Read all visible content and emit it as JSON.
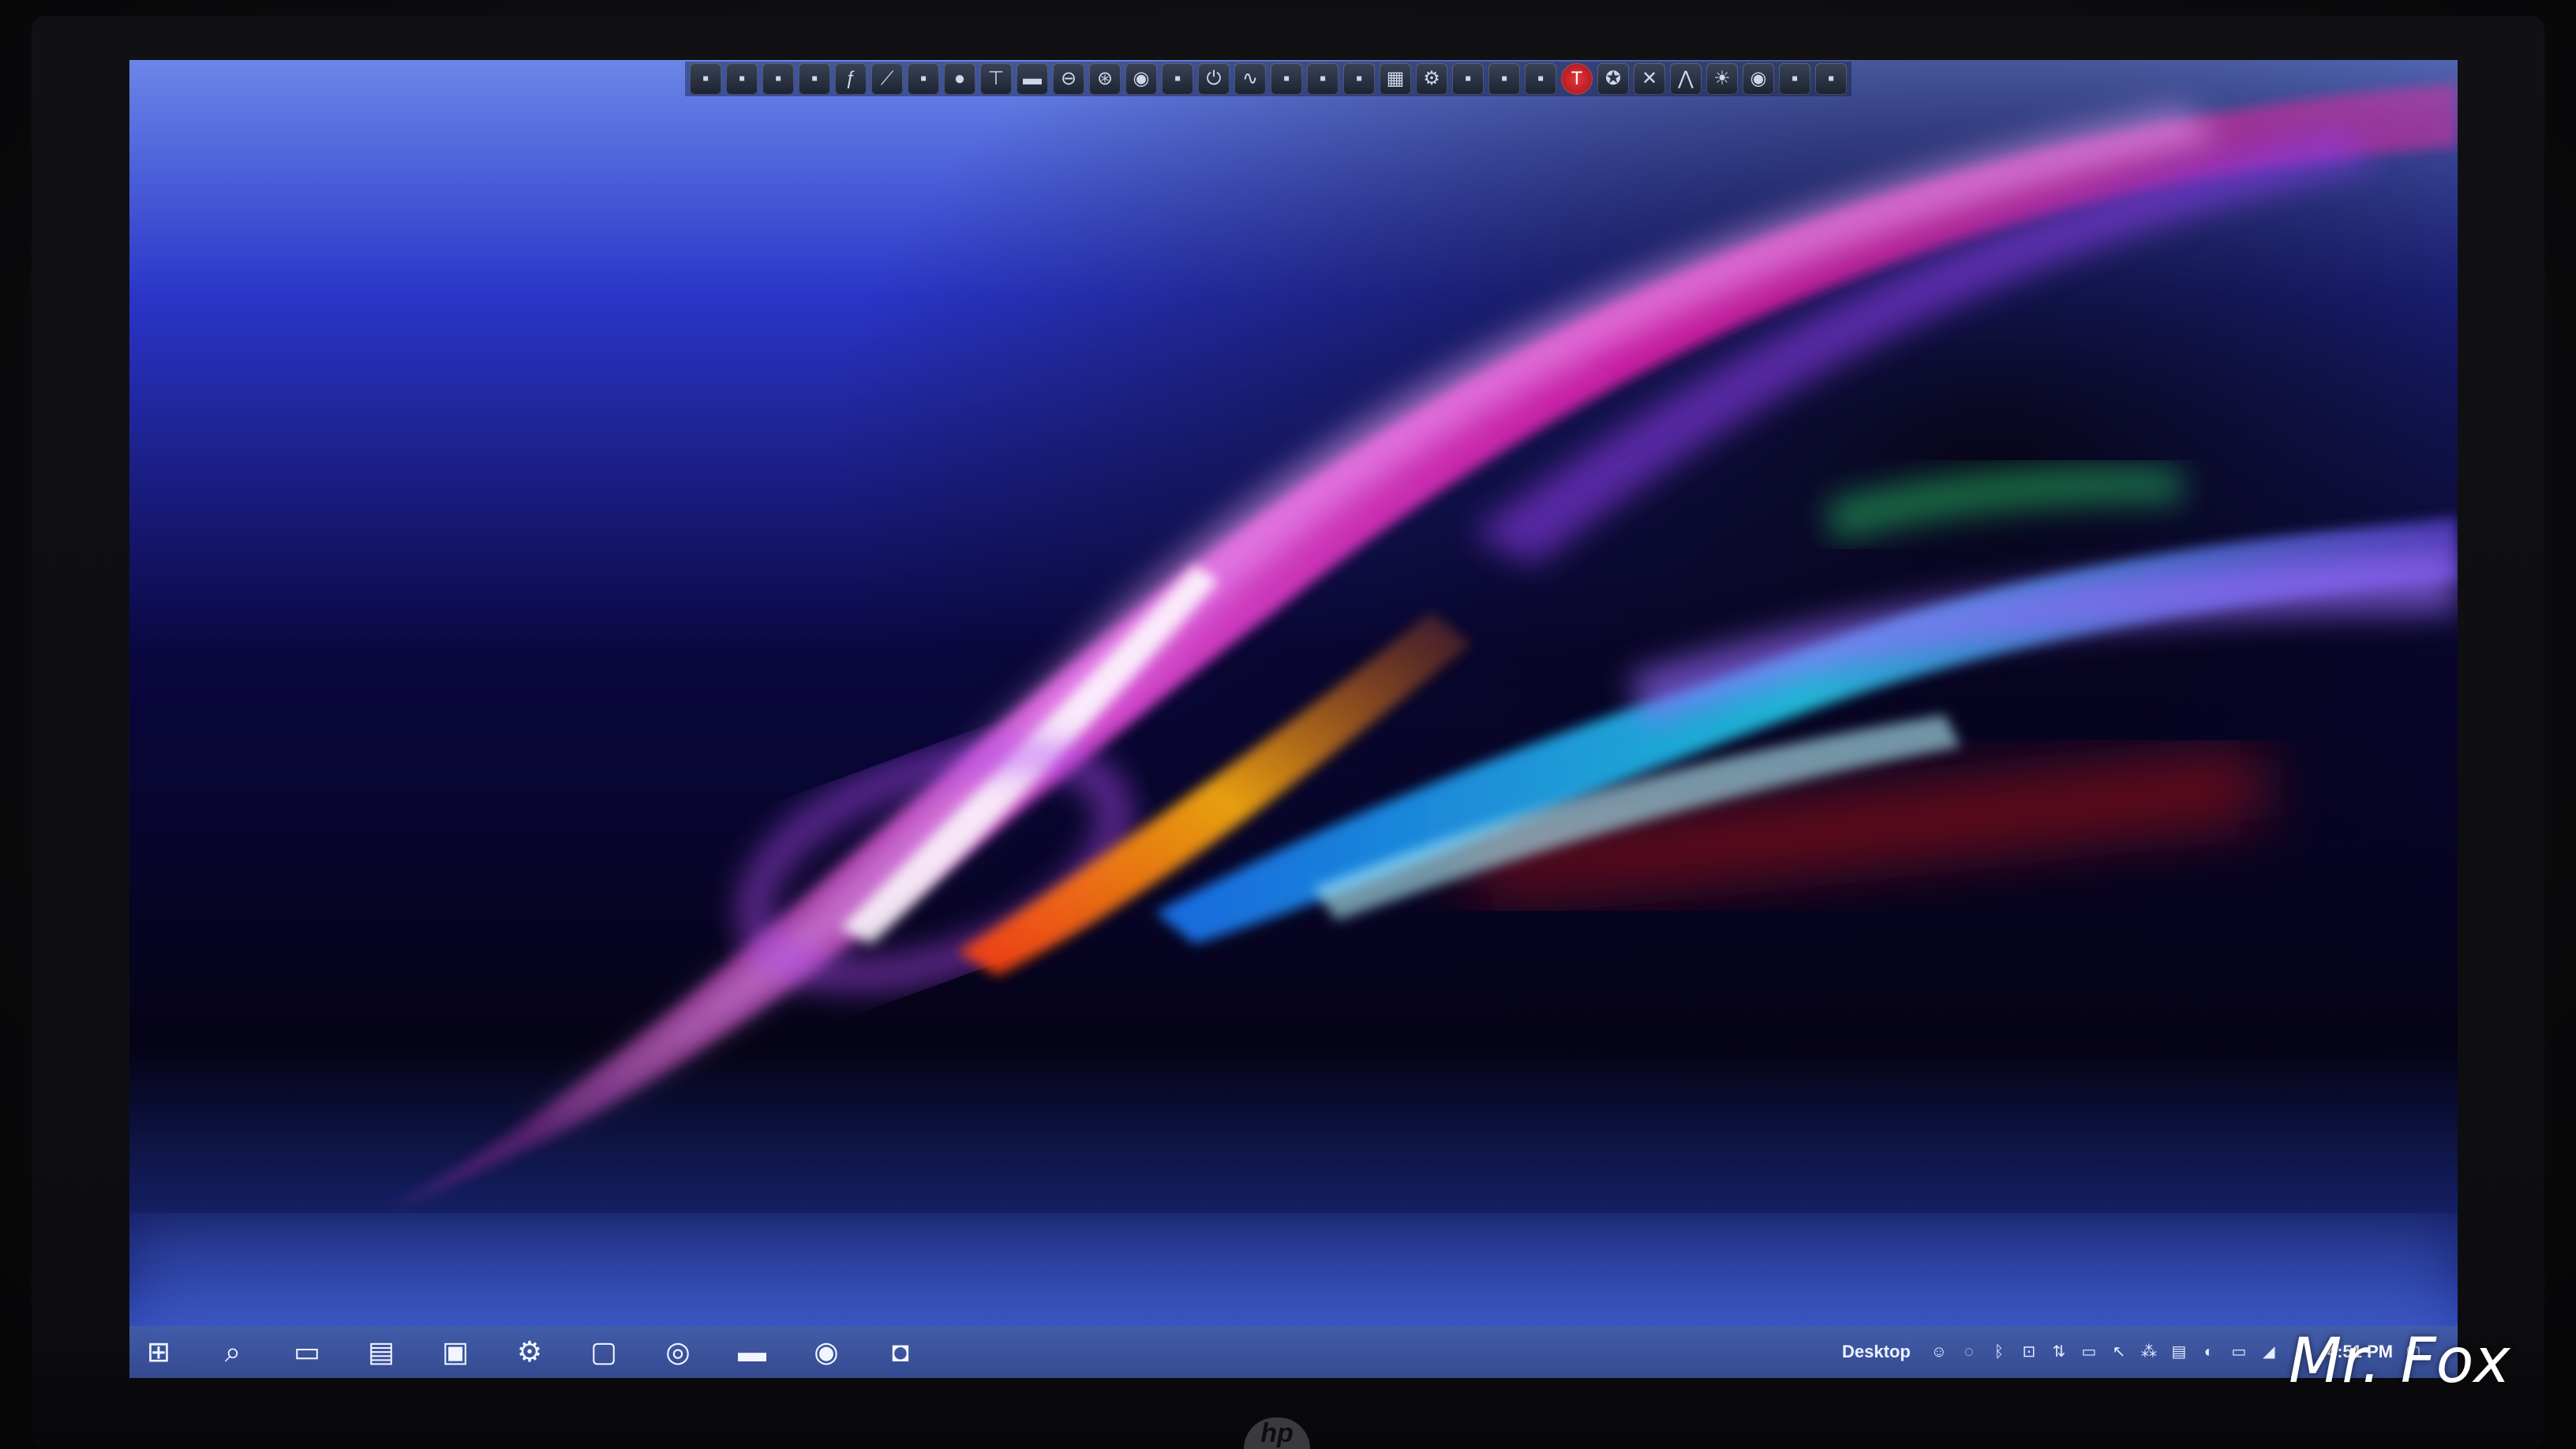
{
  "top_dock": {
    "icons": [
      {
        "name": "app-icon",
        "glyph": "▪"
      },
      {
        "name": "app-icon",
        "glyph": "▪"
      },
      {
        "name": "app-icon",
        "glyph": "▪"
      },
      {
        "name": "app-icon",
        "glyph": "▪"
      },
      {
        "name": "feather-icon",
        "glyph": "ƒ"
      },
      {
        "name": "chart-icon",
        "glyph": "⟋"
      },
      {
        "name": "app-icon",
        "glyph": "▪"
      },
      {
        "name": "disk-icon",
        "glyph": "●"
      },
      {
        "name": "app-icon",
        "glyph": "⊤"
      },
      {
        "name": "drive-icon",
        "glyph": "▬"
      },
      {
        "name": "minus-circle-icon",
        "glyph": "⊖"
      },
      {
        "name": "settings-icon",
        "glyph": "⊛"
      },
      {
        "name": "record-icon",
        "glyph": "◉"
      },
      {
        "name": "app-icon",
        "glyph": "▪"
      },
      {
        "name": "power-icon",
        "glyph": "⏻"
      },
      {
        "name": "wave-icon",
        "glyph": "∿"
      },
      {
        "name": "app-icon",
        "glyph": "▪"
      },
      {
        "name": "app-icon",
        "glyph": "▪"
      },
      {
        "name": "app-icon",
        "glyph": "▪"
      },
      {
        "name": "grid-icon",
        "glyph": "▦"
      },
      {
        "name": "gear-icon",
        "glyph": "⚙"
      },
      {
        "name": "app-icon",
        "glyph": "▪"
      },
      {
        "name": "app-icon",
        "glyph": "▪"
      },
      {
        "name": "app-icon",
        "glyph": "▪"
      },
      {
        "name": "t-badge-icon",
        "glyph": "T",
        "style": "red"
      },
      {
        "name": "compass-icon",
        "glyph": "✪"
      },
      {
        "name": "x-icon",
        "glyph": "✕"
      },
      {
        "name": "activity-icon",
        "glyph": "⋀"
      },
      {
        "name": "sun-icon",
        "glyph": "☀"
      },
      {
        "name": "eye-icon",
        "glyph": "◉"
      },
      {
        "name": "app-icon",
        "glyph": "▪"
      },
      {
        "name": "app-icon",
        "glyph": "▪"
      }
    ]
  },
  "taskbar": {
    "apps": [
      {
        "name": "start-button",
        "glyph": "⊞"
      },
      {
        "name": "search-icon",
        "glyph": "⌕"
      },
      {
        "name": "task-view-icon",
        "glyph": "▭"
      },
      {
        "name": "file-explorer-icon",
        "glyph": "▤"
      },
      {
        "name": "store-icon",
        "glyph": "▣"
      },
      {
        "name": "settings-icon",
        "glyph": "⚙"
      },
      {
        "name": "notes-icon",
        "glyph": "▢"
      },
      {
        "name": "browser-icon",
        "glyph": "◎"
      },
      {
        "name": "app-icon",
        "glyph": "▬"
      },
      {
        "name": "chrome-icon",
        "glyph": "◉"
      },
      {
        "name": "outlook-icon",
        "glyph": "◘"
      }
    ],
    "desktop_label": "Desktop",
    "tray_icons": [
      {
        "name": "people-icon",
        "glyph": "☺"
      },
      {
        "name": "chat-icon",
        "glyph": "◌"
      },
      {
        "name": "bluetooth-icon",
        "glyph": "ᛒ"
      },
      {
        "name": "usb-icon",
        "glyph": "⊡"
      },
      {
        "name": "network-icon",
        "glyph": "⇅"
      },
      {
        "name": "monitor-icon",
        "glyph": "▭"
      },
      {
        "name": "cursor-icon",
        "glyph": "↖"
      },
      {
        "name": "app-icon",
        "glyph": "⁂"
      },
      {
        "name": "app-icon",
        "glyph": "▤"
      },
      {
        "name": "paint-icon",
        "glyph": "◐"
      },
      {
        "name": "folder-icon",
        "glyph": "▭"
      },
      {
        "name": "wifi-icon",
        "glyph": "◢"
      },
      {
        "name": "volume-icon",
        "glyph": "♪"
      }
    ],
    "clock": "4:51 PM",
    "notification_icon": "▢"
  },
  "watermark": "Mr. Fox",
  "colors": {
    "taskbar": "#4a63a8",
    "wallpaper_magenta": "#e21aa8",
    "wallpaper_cyan": "#22d6f2",
    "wallpaper_orange": "#ff8a10",
    "wallpaper_blue": "#3a5ad8"
  }
}
